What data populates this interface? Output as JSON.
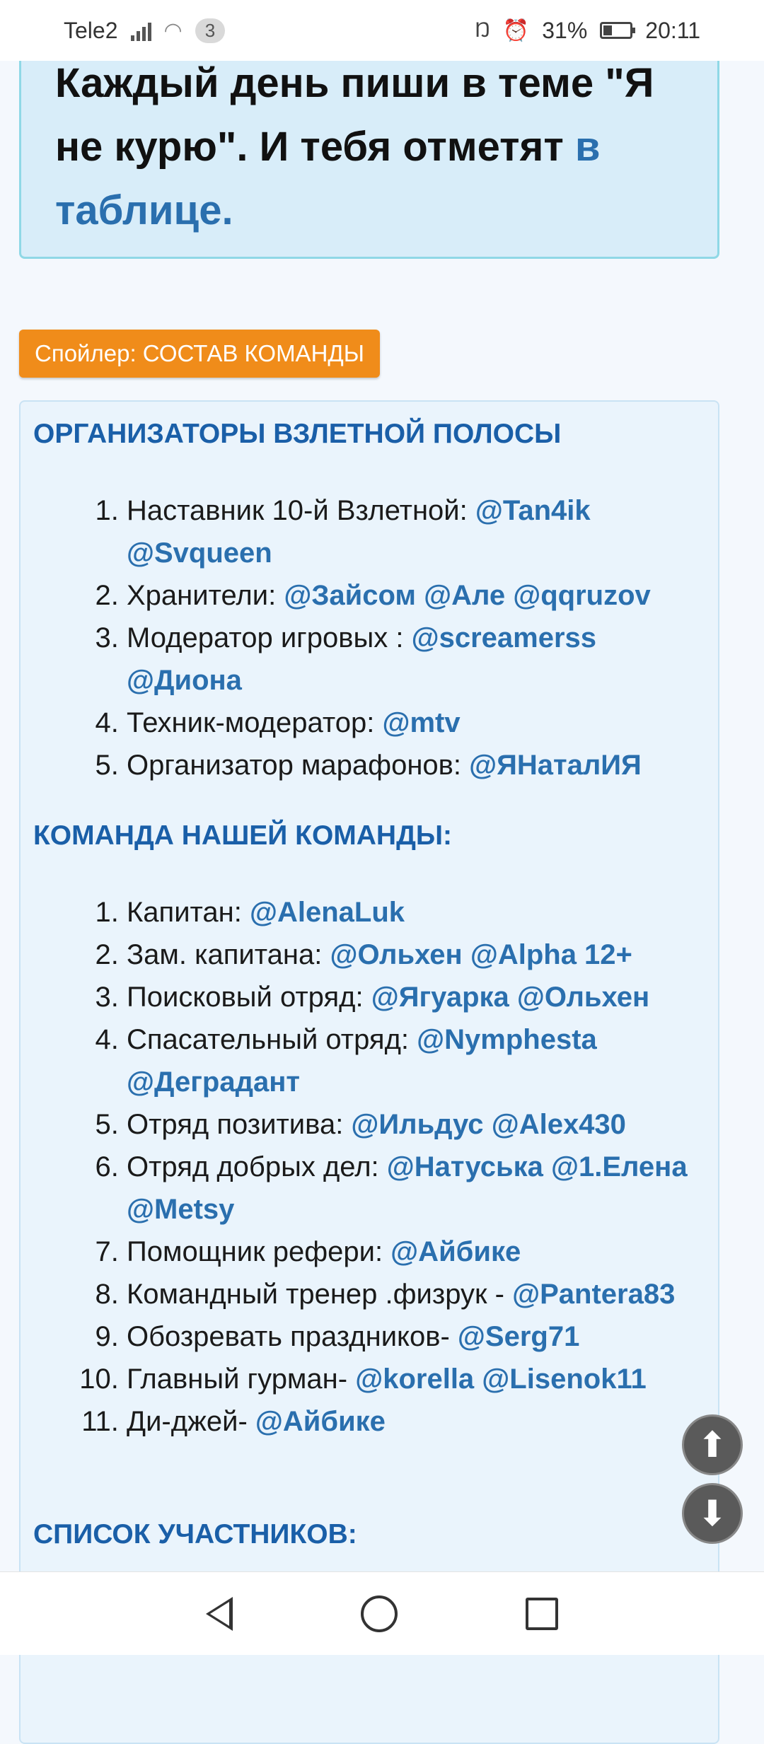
{
  "status_bar": {
    "carrier": "Tele2",
    "notification_count": "3",
    "battery": "31%",
    "time": "20:11"
  },
  "notice": {
    "text_main": "Каждый день пиши в теме \"Я не курю\". И тебя отметят ",
    "text_link": "в таблице."
  },
  "spoiler": {
    "label": "Спойлер: СОСТАВ КОМАНДЫ"
  },
  "sections": {
    "organizers_title": "ОРГАНИЗАТОРЫ ВЗЛЕТНОЙ ПОЛОСЫ",
    "team_title": "КОМАНДА НАШЕЙ КОМАНДЫ:",
    "members_title": "СПИСОК УЧАСТНИКОВ:"
  },
  "organizers": [
    {
      "role": "Наставник 10-й Взлетной: ",
      "mentions": [
        "@Tan4ik",
        "@Svqueen"
      ]
    },
    {
      "role": "Хранители: ",
      "mentions": [
        "@Зайсом",
        "@Але",
        "@qqruzov"
      ]
    },
    {
      "role": "Модератор игровых : ",
      "mentions": [
        "@screamerss",
        "@Диона"
      ]
    },
    {
      "role": "Техник-модератор: ",
      "mentions": [
        "@mtv"
      ]
    },
    {
      "role": "Организатор марафонов: ",
      "mentions": [
        "@ЯНаталИЯ"
      ]
    }
  ],
  "team": [
    {
      "role": "Капитан: ",
      "mentions": [
        "@AlenaLuk"
      ]
    },
    {
      "role": "Зам. капитана: ",
      "mentions": [
        "@Ольхен",
        "@Alpha 12+"
      ]
    },
    {
      "role": "Поисковый отряд: ",
      "mentions": [
        "@Ягуарка",
        "@Ольхен"
      ]
    },
    {
      "role": "Спасательный отряд: ",
      "mentions": [
        "@Nymphesta",
        "@Деградант"
      ]
    },
    {
      "role": "Отряд позитива: ",
      "mentions": [
        "@Ильдус",
        "@Alex430"
      ]
    },
    {
      "role": "Отряд добрых дел: ",
      "mentions": [
        "@Натуська",
        "@1.Елена",
        "@Metsy"
      ]
    },
    {
      "role": "Помощник рефери: ",
      "mentions": [
        "@Айбике"
      ]
    },
    {
      "role": "Командный тренер .физрук - ",
      "mentions": [
        "@Pantera83"
      ]
    },
    {
      "role": "Обозревать праздников- ",
      "mentions": [
        "@Serg71"
      ]
    },
    {
      "role": "Главный гурман- ",
      "mentions": [
        "@korella",
        "@Lisenok11"
      ]
    },
    {
      "role": "Ди-джей- ",
      "mentions": [
        "@Айбике"
      ]
    }
  ],
  "icons": {
    "scroll_up": "arrow-up-icon",
    "scroll_down": "arrow-down-icon"
  }
}
